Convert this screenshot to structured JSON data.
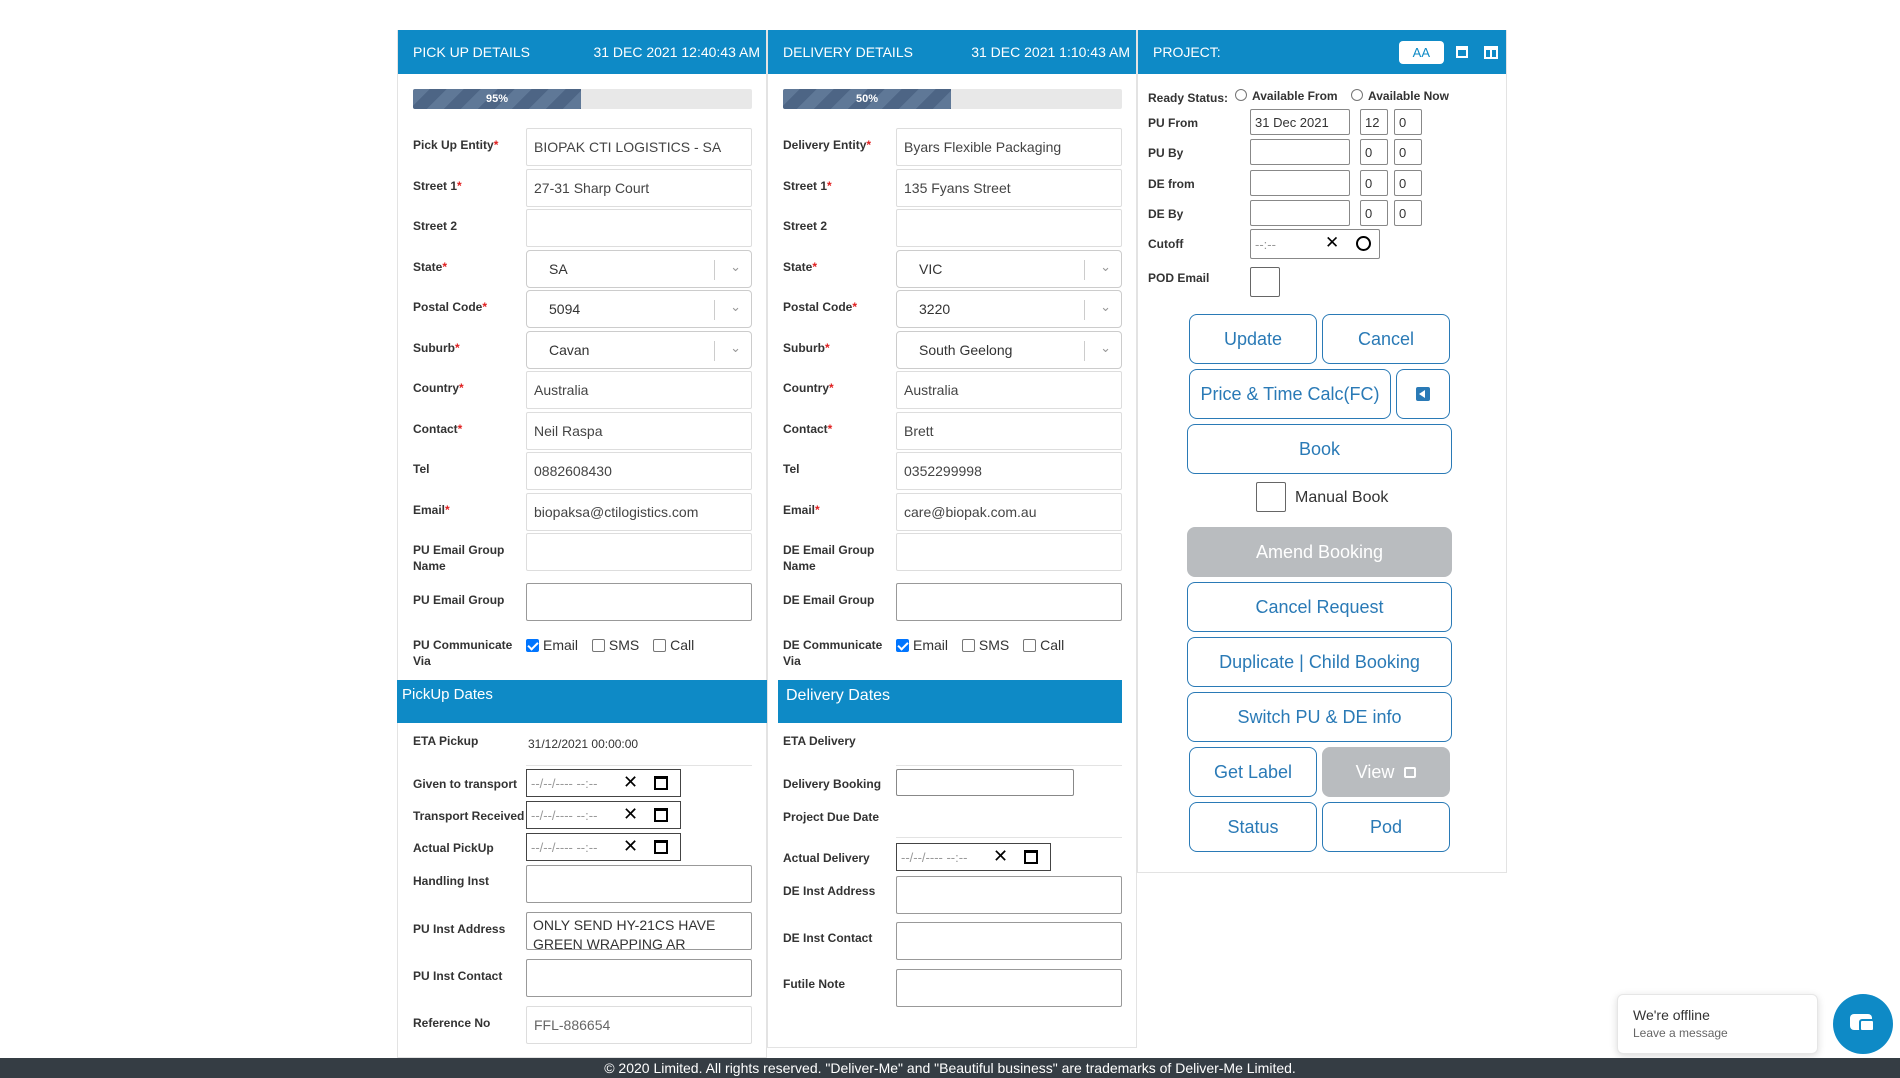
{
  "pickup": {
    "header_title": "PICK UP DETAILS",
    "header_date": "31 DEC 2021 12:40:43 AM",
    "progress_label": "95%",
    "progress_value": 95,
    "labels": {
      "entity": "Pick Up Entity",
      "street1": "Street 1",
      "street2": "Street 2",
      "state": "State",
      "postal": "Postal Code",
      "suburb": "Suburb",
      "country": "Country",
      "contact": "Contact",
      "tel": "Tel",
      "email": "Email",
      "group_name": "PU Email Group Name",
      "group": "PU Email Group",
      "communicate": "PU Communicate Via"
    },
    "values": {
      "entity": "BIOPAK CTI LOGISTICS - SA",
      "street1": "27-31 Sharp Court",
      "street2": "",
      "state": "SA",
      "postal": "5094",
      "suburb": "Cavan",
      "country": "Australia",
      "contact": "Neil Raspa",
      "tel": "0882608430",
      "email": "biopaksa@ctilogistics.com"
    },
    "communicate": {
      "email": "Email",
      "sms": "SMS",
      "call": "Call"
    },
    "dates": {
      "band_title": "PickUp Dates",
      "eta_label": "ETA Pickup",
      "eta_value": "31/12/2021 00:00:00",
      "given_label": "Given to transport",
      "received_label": "Transport Received",
      "actual_label": "Actual PickUp",
      "datetime_placeholder": "--/--/---- --:--",
      "handling_label": "Handling Inst",
      "inst_address_label": "PU Inst Address",
      "inst_address_value": "ONLY SEND HY-21CS HAVE GREEN WRAPPING AR",
      "inst_contact_label": "PU Inst Contact",
      "reference_label": "Reference No",
      "reference_value": "FFL-886654"
    }
  },
  "delivery": {
    "header_title": "DELIVERY DETAILS",
    "header_date": "31 DEC 2021 1:10:43 AM",
    "progress_label": "50%",
    "progress_value": 50,
    "labels": {
      "entity": "Delivery Entity",
      "street1": "Street 1",
      "street2": "Street 2",
      "state": "State",
      "postal": "Postal Code",
      "suburb": "Suburb",
      "country": "Country",
      "contact": "Contact",
      "tel": "Tel",
      "email": "Email",
      "group_name": "DE Email Group Name",
      "group": "DE Email Group",
      "communicate": "DE Communicate Via"
    },
    "values": {
      "entity": "Byars Flexible Packaging",
      "street1": "135 Fyans Street",
      "street2": "",
      "state": "VIC",
      "postal": "3220",
      "suburb": "South Geelong",
      "country": "Australia",
      "contact": "Brett",
      "tel": "0352299998",
      "email": "care@biopak.com.au"
    },
    "communicate": {
      "email": "Email",
      "sms": "SMS",
      "call": "Call"
    },
    "dates": {
      "band_title": "Delivery Dates",
      "eta_label": "ETA Delivery",
      "booking_label": "Delivery Booking",
      "due_label": "Project Due Date",
      "actual_label": "Actual Delivery",
      "datetime_placeholder": "--/--/---- --:--",
      "inst_address_label": "DE Inst Address",
      "inst_contact_label": "DE Inst Contact",
      "futile_label": "Futile Note"
    }
  },
  "project": {
    "header_title": "PROJECT:",
    "aa_button": "AA",
    "ready_status_label": "Ready Status:",
    "available_from": "Available From",
    "available_now": "Available Now",
    "pu_from_label": "PU From",
    "pu_from_date": "31 Dec 2021",
    "pu_from_hour": "12",
    "pu_from_min": "0",
    "pu_by_label": "PU By",
    "pu_by_hour": "0",
    "pu_by_min": "0",
    "de_from_label": "DE from",
    "de_from_hour": "0",
    "de_from_min": "0",
    "de_by_label": "DE By",
    "de_by_hour": "0",
    "de_by_min": "0",
    "cutoff_label": "Cutoff",
    "cutoff_placeholder": "--:--",
    "pod_email_label": "POD Email",
    "buttons": {
      "update": "Update",
      "cancel": "Cancel",
      "price_time": "Price & Time Calc(FC)",
      "book": "Book",
      "manual_book": "Manual Book",
      "amend_booking": "Amend Booking",
      "cancel_request": "Cancel Request",
      "duplicate": "Duplicate | Child Booking",
      "switch": "Switch PU & DE info",
      "get_label": "Get Label",
      "view": "View",
      "status": "Status",
      "pod": "Pod"
    }
  },
  "chat": {
    "title": "We're offline",
    "subtitle": "Leave a message"
  },
  "footer": "© 2020 Limited. All rights reserved. \"Deliver-Me\" and \"Beautiful business\" are trademarks of Deliver-Me Limited.",
  "colors": {
    "header_blue": "#0e8ac6",
    "button_blue": "#2a7ab6",
    "required_red": "#e02020",
    "footer_bg": "#353d44"
  }
}
